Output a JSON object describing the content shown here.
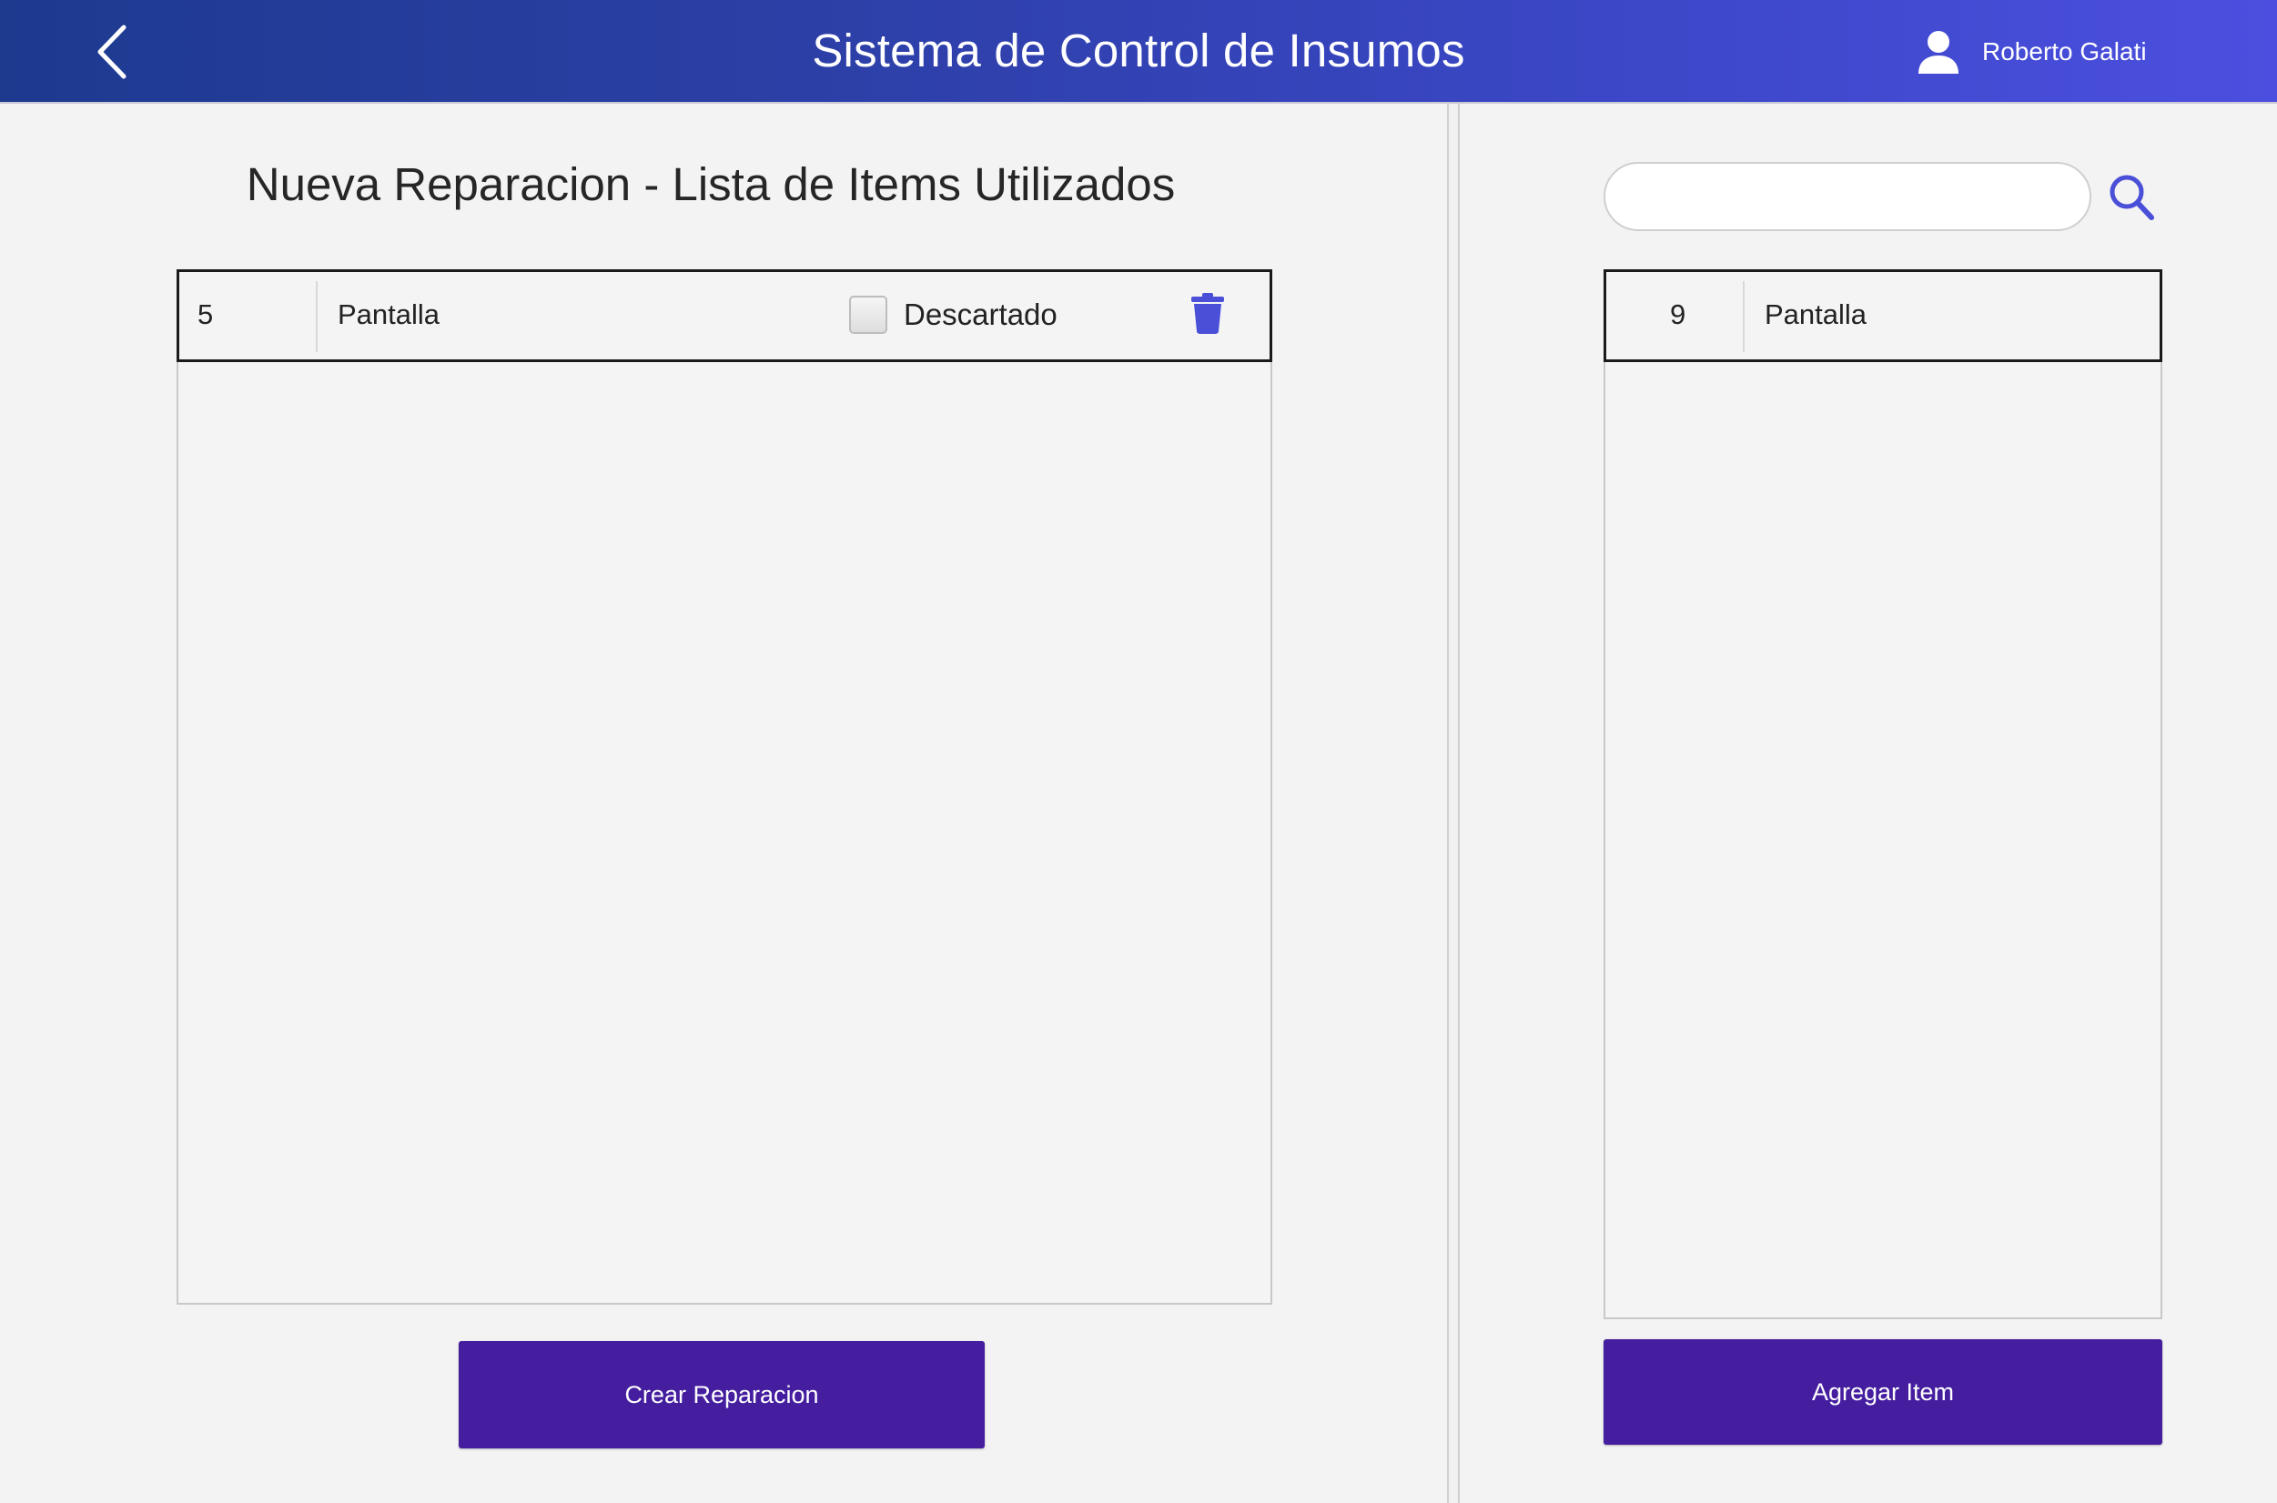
{
  "header": {
    "title": "Sistema de Control de Insumos",
    "user_name": "Roberto Galati",
    "back_icon": "chevron-left-icon",
    "user_icon": "user-icon",
    "background_start": "#1d3a8f",
    "background_end": "#4b4fdf"
  },
  "left": {
    "title": "Nueva Reparacion - Lista de Items Utilizados",
    "items": [
      {
        "qty": "5",
        "name": "Pantalla",
        "checkbox_label": "Descartado",
        "checked": false,
        "delete_icon": "trash-icon"
      }
    ],
    "button_label": "Crear Reparacion"
  },
  "right": {
    "search": {
      "value": "",
      "placeholder": "",
      "icon": "search-icon"
    },
    "items": [
      {
        "qty": "9",
        "name": "Pantalla"
      }
    ],
    "button_label": "Agregar Item"
  },
  "colors": {
    "accent": "#4a4fd8",
    "button": "#451ea0",
    "background": "#f3f3f3"
  }
}
